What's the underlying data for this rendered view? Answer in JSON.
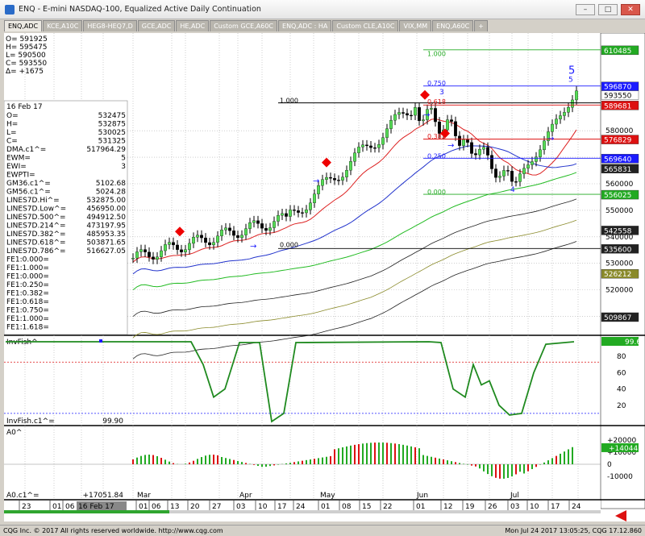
{
  "window": {
    "title": "ENQ - E-mini NASDAQ-100, Equalized Active Daily Continuation"
  },
  "tabs": [
    "ENQ,ADC",
    "KCE,A10C",
    "HEG8-HEQ7,D",
    "GCE,ADC",
    "HE,ADC",
    "Custom GCE,A60C",
    "ENQ,ADC : HA",
    "Custom CLE,A10C",
    "VIX,MM",
    "ENQ,A60C",
    "+"
  ],
  "ohlc_top": [
    "O=  591925",
    "H=  595475",
    "L=  590500",
    "C=  593550",
    "Δ=   +1675"
  ],
  "info_box": {
    "date": "16 Feb 17",
    "rows": [
      [
        "O=",
        "532475"
      ],
      [
        "H=",
        "532875"
      ],
      [
        "L=",
        "530025"
      ],
      [
        "C=",
        "531325"
      ],
      [
        "DMA.c1^=",
        "517964.29"
      ],
      [
        "EWM=",
        "5"
      ],
      [
        "EWI=",
        "3"
      ],
      [
        "EWPTI=",
        ""
      ],
      [
        "GM36.c1^=",
        "5102.68"
      ],
      [
        "GM56.c1^=",
        "5024.28"
      ],
      [
        "LINES7D.Hi^=",
        "532875.00"
      ],
      [
        "LINES7D.Low^=",
        "456950.00"
      ],
      [
        "LINES7D.500^=",
        "494912.50"
      ],
      [
        "LINES7D.214^=",
        "473197.95"
      ],
      [
        "LINES7D.382^=",
        "485953.35"
      ],
      [
        "LINES7D.618^=",
        "503871.65"
      ],
      [
        "LINES7D.786^=",
        "516627.05"
      ],
      [
        "FE1:0.000=",
        ""
      ],
      [
        "FE1:1.000=",
        ""
      ],
      [
        "FE1:0.000=",
        ""
      ],
      [
        "FE1:0.250=",
        ""
      ],
      [
        "FE1:0.382=",
        ""
      ],
      [
        "FE1:0.618=",
        ""
      ],
      [
        "FE1:0.750=",
        ""
      ],
      [
        "FE1:1.000=",
        ""
      ],
      [
        "FE1:1.618=",
        ""
      ]
    ]
  },
  "price_badges": [
    {
      "label": "610485",
      "bg": "#22aa22",
      "fg": "#ffffff",
      "y": 610485
    },
    {
      "label": "596870",
      "bg": "#1a1aff",
      "fg": "#ffffff",
      "y": 596870
    },
    {
      "label": "593550",
      "bg": "#ffffff",
      "fg": "#000000",
      "y": 593550
    },
    {
      "label": "589681",
      "bg": "#dd1111",
      "fg": "#ffffff",
      "y": 589681
    },
    {
      "label": "576829",
      "bg": "#dd1111",
      "fg": "#ffffff",
      "y": 576829
    },
    {
      "label": "569640",
      "bg": "#1a1aff",
      "fg": "#ffffff",
      "y": 569640
    },
    {
      "label": "565831",
      "bg": "#222222",
      "fg": "#ffffff",
      "y": 565831
    },
    {
      "label": "556025",
      "bg": "#22aa22",
      "fg": "#ffffff",
      "y": 556025
    },
    {
      "label": "542558",
      "bg": "#222222",
      "fg": "#ffffff",
      "y": 542558
    },
    {
      "label": "535600",
      "bg": "#222222",
      "fg": "#ffffff",
      "y": 535600
    },
    {
      "label": "526212",
      "bg": "#8a8a2a",
      "fg": "#ffffff",
      "y": 526212
    },
    {
      "label": "509867",
      "bg": "#222222",
      "fg": "#ffffff",
      "y": 509867
    }
  ],
  "price_axis": [
    "580000",
    "570000",
    "560000",
    "550000",
    "540000",
    "530000",
    "520000",
    "510000"
  ],
  "fib_labels": [
    {
      "text": "1.000",
      "color": "#22aa22"
    },
    {
      "text": "0.750",
      "color": "#1a1aff"
    },
    {
      "text": "0.618",
      "color": "#dd1111"
    },
    {
      "text": "1.000",
      "color": "#000000"
    },
    {
      "text": "0.382",
      "color": "#dd1111"
    },
    {
      "text": "0.250",
      "color": "#1a1aff"
    },
    {
      "text": "0.000",
      "color": "#22aa22"
    },
    {
      "text": "0.000",
      "color": "#000000"
    }
  ],
  "wave_labels": [
    "5",
    "5",
    "3",
    "4"
  ],
  "invfish": {
    "title": "InvFish^",
    "value_label": "InvFish.c1^=",
    "value": "99.90",
    "badge": "99.6",
    "axis": [
      "80",
      "60",
      "40",
      "20"
    ]
  },
  "ao": {
    "title": "A0^",
    "value_label": "A0.c1^=",
    "value": "+17051.84",
    "badge": "+14044",
    "axis": [
      "+20000",
      "+10000",
      "0",
      "-10000"
    ]
  },
  "month_labels": [
    "Mar",
    "Apr",
    "May",
    "Jun",
    "Jul"
  ],
  "date_labels": [
    "23",
    "01",
    "06",
    "16 Feb 17",
    "01",
    "06",
    "13",
    "20",
    "27",
    "03",
    "10",
    "17",
    "24",
    "01",
    "08",
    "15",
    "22",
    "01",
    "12",
    "19",
    "26",
    "03",
    "10",
    "17",
    "24"
  ],
  "status": {
    "left": "CQG Inc. © 2017 All rights reserved worldwide. http://www.cqg.com",
    "right": "Mon Jul 24 2017 13:05:25, CQG 17.12.860"
  },
  "chart_data": {
    "type": "candlestick",
    "title": "ENQ - E-mini NASDAQ-100, Equalized Active Daily Continuation",
    "x": [
      "Feb",
      "Mar",
      "Apr",
      "May",
      "Jun",
      "Jul"
    ],
    "close_approx": [
      531325,
      535000,
      538000,
      545000,
      570000,
      580000,
      583000,
      575000,
      566000,
      560000,
      575000,
      593550
    ],
    "ylim": [
      505000,
      615000
    ]
  }
}
